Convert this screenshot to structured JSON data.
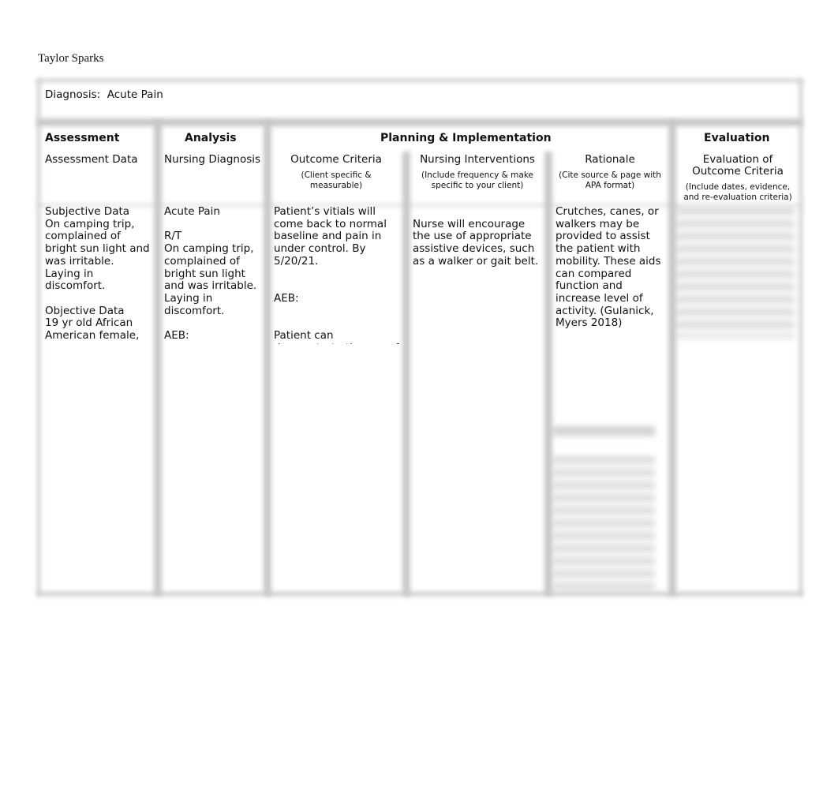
{
  "author": "Taylor Sparks",
  "diagnosis": {
    "label": "Diagnosis:",
    "value": "Acute Pain"
  },
  "sections": {
    "assessment": "Assessment",
    "analysis": "Analysis",
    "planning": "Planning & Implementation",
    "evaluation": "Evaluation"
  },
  "columns": {
    "assessment_data": {
      "title": "Assessment Data",
      "note": ""
    },
    "nursing_diagnosis": {
      "title": "Nursing Diagnosis",
      "note": ""
    },
    "outcome_criteria": {
      "title": "Outcome Criteria",
      "note": "(Client specific &\nmeasurable)"
    },
    "nursing_interventions": {
      "title": "Nursing Interventions",
      "note": "(Include frequency & make\nspecific to your client)"
    },
    "rationale": {
      "title": "Rationale",
      "note": "(Cite source & page with\nAPA format)"
    },
    "evaluation": {
      "title": "Evaluation of\nOutcome Criteria",
      "note": "(Include dates, evidence,\nand re-evaluation criteria)"
    }
  },
  "content": {
    "assessment": "Subjective Data\nOn camping trip,\ncomplained of\nbright sun light and\nwas irritable.\nLaying in\ndiscomfort.\n\nObjective Data\n19 yr old African\nAmerican female,",
    "analysis": "Acute Pain\n\nR/T\nOn camping trip,\ncomplained of\nbright sun light\nand was irritable.\nLaying in\ndiscomfort.\n\nAEB:",
    "outcome": "Patient’s vitials will\ncome back to normal\nbaseline and pain in\nunder control. By\n5/20/21.\n\n\nAEB:\n\n\nPatient can\ndemonstrate the use of",
    "interventions": "\nNurse will encourage\nthe use of appropriate\nassistive devices, such\nas a walker or gait belt.",
    "rationale": "Crutches, canes, or\nwalkers may be\nprovided to assist\nthe patient with\nmobility. These aids\ncan compared\nfunction and\nincrease level of\nactivity.  (Gulanick,\nMyers 2018)"
  }
}
